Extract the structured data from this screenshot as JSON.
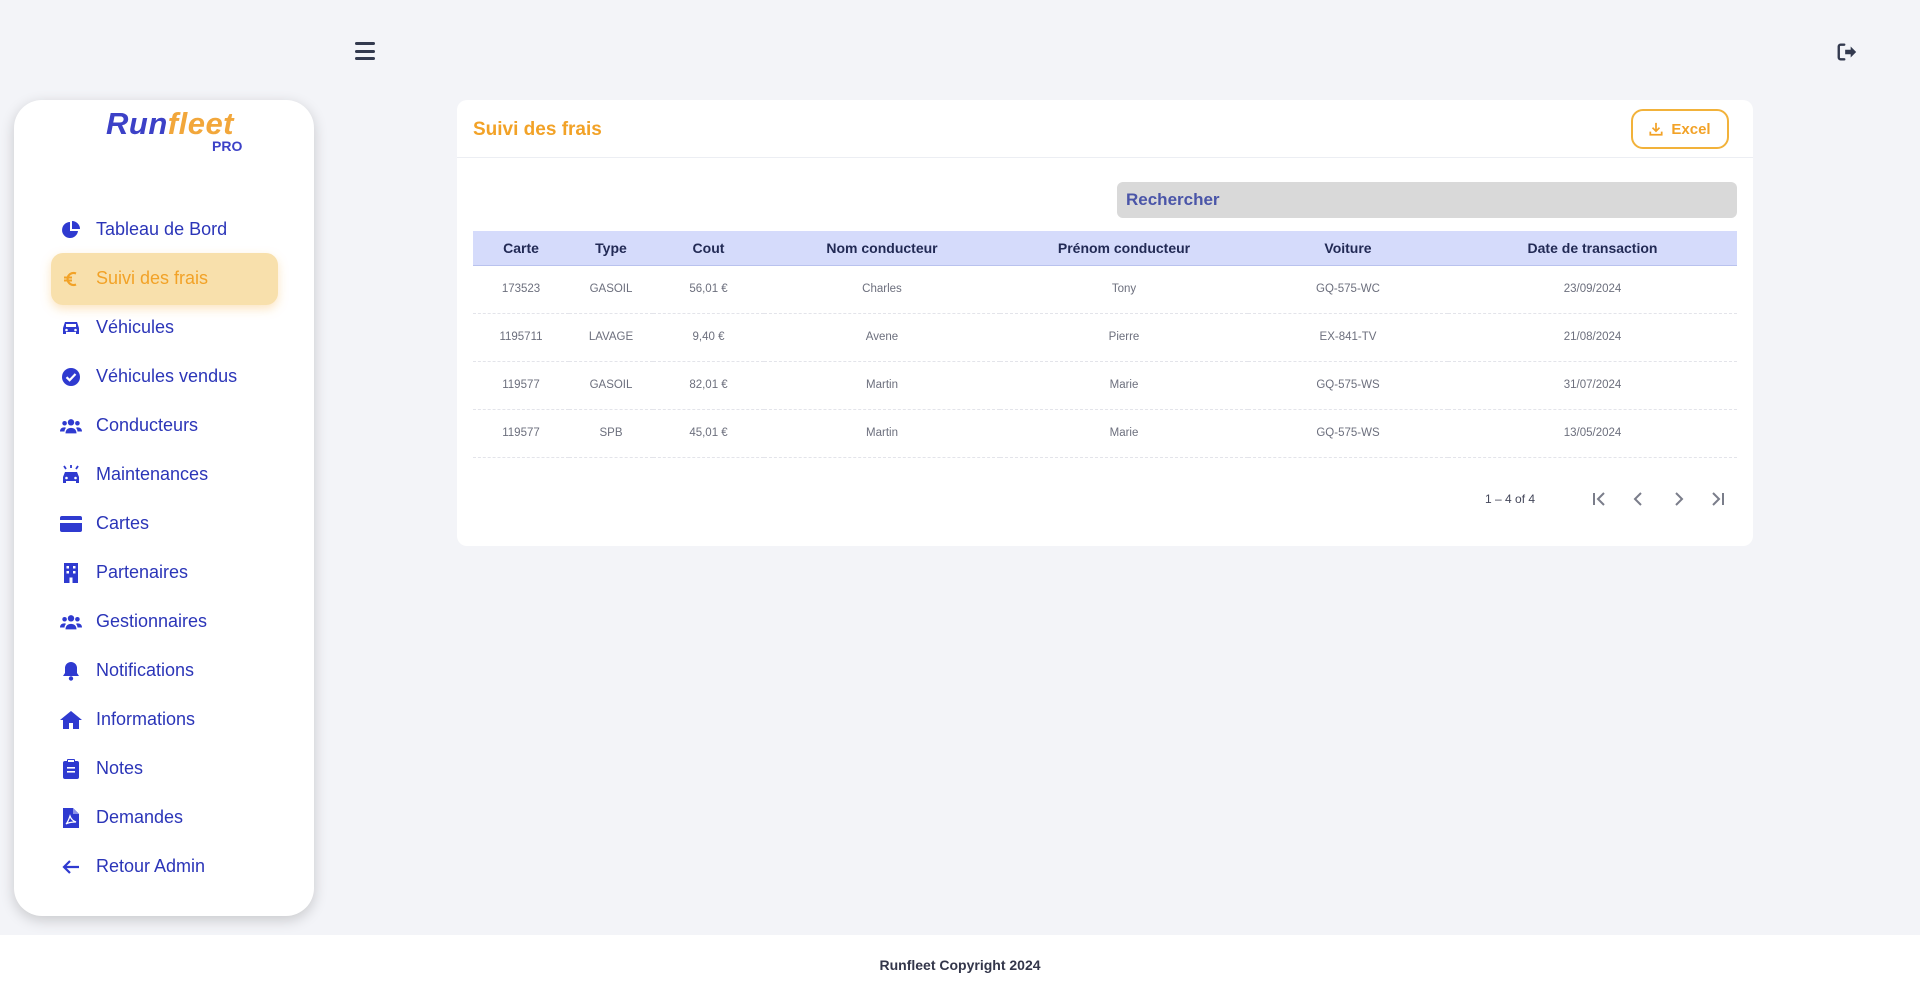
{
  "app": {
    "logo_text_run": "Run",
    "logo_text_fleet": "fleet",
    "logo_text_pro": "PRO"
  },
  "sidebar": {
    "items": [
      {
        "label": "Tableau de Bord",
        "icon": "pie-chart-icon",
        "active": false
      },
      {
        "label": "Suivi des frais",
        "icon": "euro-icon",
        "active": true
      },
      {
        "label": "Véhicules",
        "icon": "car-icon",
        "active": false
      },
      {
        "label": "Véhicules vendus",
        "icon": "check-circle-icon",
        "active": false
      },
      {
        "label": "Conducteurs",
        "icon": "users-icon",
        "active": false
      },
      {
        "label": "Maintenances",
        "icon": "car-service-icon",
        "active": false
      },
      {
        "label": "Cartes",
        "icon": "credit-card-icon",
        "active": false
      },
      {
        "label": "Partenaires",
        "icon": "building-icon",
        "active": false
      },
      {
        "label": "Gestionnaires",
        "icon": "users-icon",
        "active": false
      },
      {
        "label": "Notifications",
        "icon": "bell-icon",
        "active": false
      },
      {
        "label": "Informations",
        "icon": "home-icon",
        "active": false
      },
      {
        "label": "Notes",
        "icon": "clipboard-icon",
        "active": false
      },
      {
        "label": "Demandes",
        "icon": "pdf-file-icon",
        "active": false
      },
      {
        "label": "Retour Admin",
        "icon": "arrow-left-icon",
        "active": false
      }
    ]
  },
  "main": {
    "title": "Suivi des frais",
    "excel_label": "Excel",
    "search_placeholder": "Rechercher",
    "columns": [
      "Carte",
      "Type",
      "Cout",
      "Nom conducteur",
      "Prénom conducteur",
      "Voiture",
      "Date de transaction"
    ],
    "rows": [
      [
        "173523",
        "GASOIL",
        "56,01 €",
        "Charles",
        "Tony",
        "GQ-575-WC",
        "23/09/2024"
      ],
      [
        "1195711",
        "LAVAGE",
        "9,40 €",
        "Avene",
        "Pierre",
        "EX-841-TV",
        "21/08/2024"
      ],
      [
        "119577",
        "GASOIL",
        "82,01 €",
        "Martin",
        "Marie",
        "GQ-575-WS",
        "31/07/2024"
      ],
      [
        "119577",
        "SPB",
        "45,01 €",
        "Martin",
        "Marie",
        "GQ-575-WS",
        "13/05/2024"
      ]
    ],
    "pagination": {
      "range": "1 – 4 of 4"
    }
  },
  "footer": {
    "text": "Runfleet Copyright 2024"
  },
  "colors": {
    "accent": "#f2a227",
    "nav_text": "#2b35b8",
    "header_bg": "#d5dbfb",
    "active_bg": "#f8e0ac"
  }
}
